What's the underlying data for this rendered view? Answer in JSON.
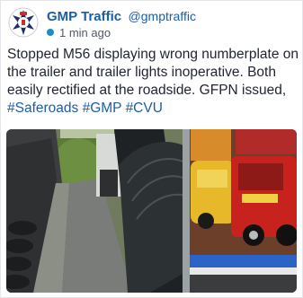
{
  "account": {
    "display_name": "GMP Traffic",
    "handle": "@gmptraffic",
    "timestamp": "1 min ago",
    "avatar_icon": "police-crest-icon",
    "status_color": "#1b8ec4"
  },
  "tweet": {
    "body": "Stopped M56 displaying wrong numberplate on the trailer and trailer lights inoperative. Both easily rectified at the roadside. GFPN issued,",
    "hashtags": [
      "#Saferoads",
      "#GMP",
      "#CVU"
    ]
  },
  "media": {
    "type": "photo",
    "subject": "trailer-with-fairground-ride-cars"
  },
  "colors": {
    "link": "#1b5ea8",
    "text": "#1f2430",
    "meta": "#555a66"
  }
}
